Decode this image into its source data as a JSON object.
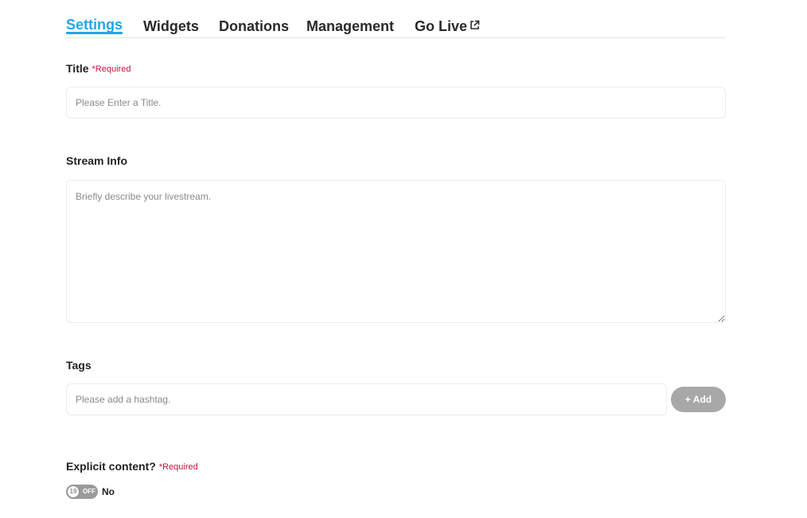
{
  "tabs": {
    "settings": "Settings",
    "widgets": "Widgets",
    "donations": "Donations",
    "management": "Management",
    "go_live": "Go Live",
    "active": "settings",
    "accent_color": "#1fa7e8"
  },
  "form": {
    "title": {
      "label": "Title",
      "required": "*Required",
      "placeholder": "Please Enter a Title.",
      "value": ""
    },
    "stream_info": {
      "label": "Stream Info",
      "placeholder": "Briefly describe your livestream.",
      "value": ""
    },
    "tags": {
      "label": "Tags",
      "placeholder": "Please add a hashtag.",
      "value": "",
      "add_label": "+ Add"
    },
    "explicit": {
      "label": "Explicit content?",
      "required": "*Required",
      "toggle_badge": "19",
      "toggle_state": "OFF",
      "value_text": "No"
    }
  },
  "colors": {
    "required": "#d0103a",
    "button_disabled": "#a8a8a8",
    "toggle_off": "#9b9b9b"
  },
  "icons": {
    "go_live": "external-link-icon"
  }
}
